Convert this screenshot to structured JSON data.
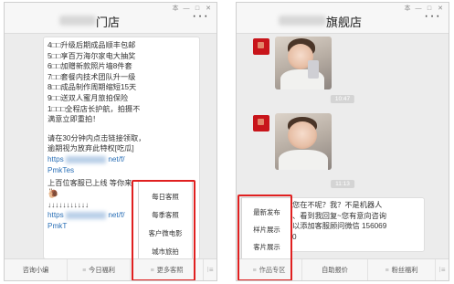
{
  "left_panel": {
    "title": "门店",
    "more": "···",
    "window_controls": [
      "本",
      "—",
      "□",
      "✕"
    ],
    "message_lines": [
      "4□□升级后期成品顺丰包邮",
      "5□□享百万海尔家电大抽奖",
      "6□□加赠新款照片墙8件套",
      "7□□套餐内技术团队升一级",
      "8□□成品制作周期缩短15天",
      "9□□送双人蜜月旅拍保险",
      "1□□□全程店长护航，拍摄不",
      "满意立即重拍！"
    ],
    "cta_lines": [
      "请在30分钟内点击链接领取，",
      "逾期视为放弃此特权[吃瓜]"
    ],
    "link1_prefix": "https",
    "link1_suffix": "net/f/",
    "link1_line2": "PmkTes",
    "reserve_prefix": "上百位客服已上线 等你来",
    "arrows": "↓↓↓↓↓↓↓↓↓↓↓",
    "link2_prefix": "https",
    "link2_suffix": "net/f/",
    "link2_line2": "PmkT",
    "popup_menu": [
      "每日客照",
      "每季客照",
      "客户微电影",
      "城市旅拍"
    ],
    "tabs": [
      "咨询小编",
      "今日福利",
      "更多客照"
    ]
  },
  "right_panel": {
    "title": "旗舰店",
    "more": "···",
    "window_controls": [
      "本",
      "—",
      "□",
      "✕"
    ],
    "time1": "10:47",
    "time2": "11:13",
    "auto_reply_lines": [
      "您在不呢？我？不是机器人",
      "、看到我回复~您有意向咨询",
      "以添加客服顾问微信 156069",
      "0"
    ],
    "popup_menu": [
      "最新发布",
      "样片展示",
      "客片展示"
    ],
    "tabs": [
      "作品专区",
      "自助报价",
      "粉丝福利"
    ]
  }
}
